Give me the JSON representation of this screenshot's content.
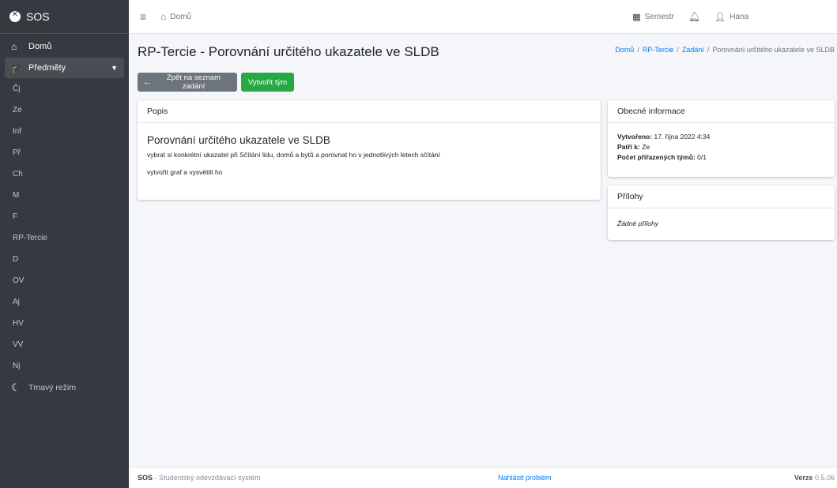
{
  "brand": {
    "name": "SOS"
  },
  "sidebar": {
    "home_label": "Domů",
    "subjects_label": "Předměty",
    "subjects": [
      "Čj",
      "Ze",
      "Inf",
      "Př",
      "Ch",
      "M",
      "F",
      "RP-Tercie",
      "D",
      "OV",
      "Aj",
      "HV",
      "VV",
      "Nj"
    ],
    "dark_mode_label": "Tmavý režim"
  },
  "header": {
    "home_label": "Domů",
    "semester_label": "Semestr",
    "user_name": "Hana"
  },
  "page": {
    "title": "RP-Tercie - Porovnání určitého ukazatele ve SLDB",
    "breadcrumb": {
      "home": "Domů",
      "subject": "RP-Tercie",
      "assignments": "Zadání",
      "current": "Porovnání určitého ukazatele ve SLDB",
      "separator": "/"
    },
    "back_button": "Zpět na seznam zadání",
    "create_team_button": "Vytvořit tým"
  },
  "description_card": {
    "header": "Popis",
    "heading": "Porovnání určitého ukazatele ve SLDB",
    "paragraph1": "vybrat si konkrétní ukazatel při Sčítání lidu, domů a bytů a porovnat ho v jednotlivých letech sčítání",
    "paragraph2": "vytvořit graf a vysvětlit ho"
  },
  "info_card": {
    "header": "Obecné informace",
    "created_label": "Vytvořeno:",
    "created_value": "17. října 2022 4:34",
    "belongs_label": "Patří k:",
    "belongs_value": "Ze",
    "teams_label": "Počet přiřazených týmů:",
    "teams_value": "0/1"
  },
  "attachments_card": {
    "header": "Přílohy",
    "empty_text": "Žádné přílohy"
  },
  "footer": {
    "brand": "SOS",
    "tagline": " - Studentský odevzdávací systém",
    "report_link": "Nahlásit problém",
    "version_label": "Verze",
    "version_value": "0.5.06"
  }
}
